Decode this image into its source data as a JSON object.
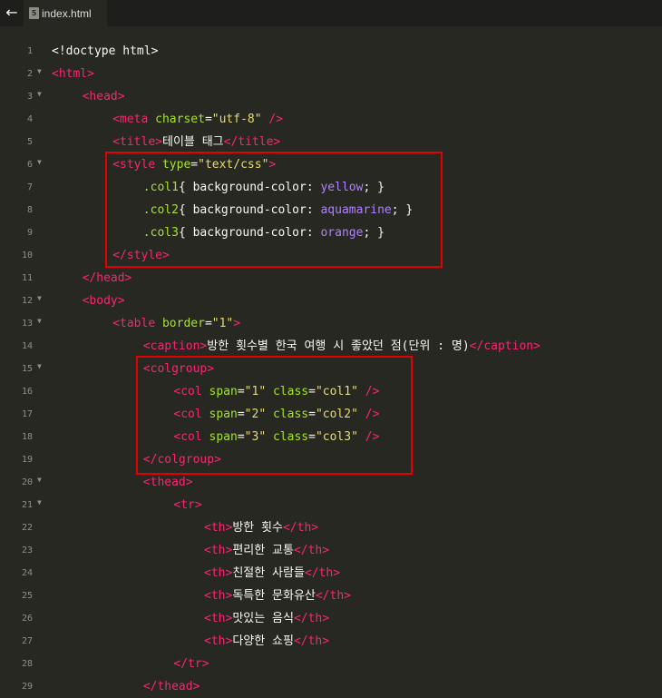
{
  "tab": {
    "back_glyph": "←",
    "icon_glyph": "5",
    "file_name": "index.html"
  },
  "lines": [
    {
      "n": "1",
      "fold": false,
      "indent": 0,
      "tokens": [
        {
          "t": "<!doctype html>",
          "c": "txt"
        }
      ]
    },
    {
      "n": "2",
      "fold": true,
      "indent": 0,
      "tokens": [
        {
          "t": "<html>",
          "c": "tag"
        }
      ]
    },
    {
      "n": "3",
      "fold": true,
      "indent": 1,
      "tokens": [
        {
          "t": "<head>",
          "c": "tag"
        }
      ]
    },
    {
      "n": "4",
      "fold": false,
      "indent": 2,
      "tokens": [
        {
          "t": "<meta ",
          "c": "tag"
        },
        {
          "t": "charset",
          "c": "attr"
        },
        {
          "t": "=",
          "c": "txt"
        },
        {
          "t": "\"utf-8\"",
          "c": "str"
        },
        {
          "t": " />",
          "c": "tag"
        }
      ]
    },
    {
      "n": "5",
      "fold": false,
      "indent": 2,
      "tokens": [
        {
          "t": "<title>",
          "c": "tag"
        },
        {
          "t": "테이블 태그",
          "c": "txt"
        },
        {
          "t": "</title>",
          "c": "tag"
        }
      ]
    },
    {
      "n": "6",
      "fold": true,
      "indent": 2,
      "tokens": [
        {
          "t": "<style ",
          "c": "tag"
        },
        {
          "t": "type",
          "c": "attr"
        },
        {
          "t": "=",
          "c": "txt"
        },
        {
          "t": "\"text/css\"",
          "c": "str"
        },
        {
          "t": ">",
          "c": "tag"
        }
      ]
    },
    {
      "n": "7",
      "fold": false,
      "indent": 3,
      "tokens": [
        {
          "t": ".col1",
          "c": "cls"
        },
        {
          "t": "{ background-color: ",
          "c": "txt"
        },
        {
          "t": "yellow",
          "c": "val"
        },
        {
          "t": "; }",
          "c": "txt"
        }
      ]
    },
    {
      "n": "8",
      "fold": false,
      "indent": 3,
      "tokens": [
        {
          "t": ".col2",
          "c": "cls"
        },
        {
          "t": "{ background-color: ",
          "c": "txt"
        },
        {
          "t": "aquamarine",
          "c": "val"
        },
        {
          "t": "; }",
          "c": "txt"
        }
      ]
    },
    {
      "n": "9",
      "fold": false,
      "indent": 3,
      "tokens": [
        {
          "t": ".col3",
          "c": "cls"
        },
        {
          "t": "{ background-color: ",
          "c": "txt"
        },
        {
          "t": "orange",
          "c": "val"
        },
        {
          "t": "; }",
          "c": "txt"
        }
      ]
    },
    {
      "n": "10",
      "fold": false,
      "indent": 2,
      "tokens": [
        {
          "t": "</style>",
          "c": "tag"
        }
      ]
    },
    {
      "n": "11",
      "fold": false,
      "indent": 1,
      "tokens": [
        {
          "t": "</head>",
          "c": "tag"
        }
      ]
    },
    {
      "n": "12",
      "fold": true,
      "indent": 1,
      "tokens": [
        {
          "t": "<body>",
          "c": "tag"
        }
      ]
    },
    {
      "n": "13",
      "fold": true,
      "indent": 2,
      "tokens": [
        {
          "t": "<table ",
          "c": "tag"
        },
        {
          "t": "border",
          "c": "attr"
        },
        {
          "t": "=",
          "c": "txt"
        },
        {
          "t": "\"1\"",
          "c": "str"
        },
        {
          "t": ">",
          "c": "tag"
        }
      ]
    },
    {
      "n": "14",
      "fold": false,
      "indent": 3,
      "tokens": [
        {
          "t": "<caption>",
          "c": "tag"
        },
        {
          "t": "방한 횟수별 한국 여행 시 좋았던 점(단위 : 명)",
          "c": "txt"
        },
        {
          "t": "</caption>",
          "c": "tag"
        }
      ]
    },
    {
      "n": "15",
      "fold": true,
      "indent": 3,
      "tokens": [
        {
          "t": "<colgroup>",
          "c": "tag"
        }
      ]
    },
    {
      "n": "16",
      "fold": false,
      "indent": 4,
      "tokens": [
        {
          "t": "<col ",
          "c": "tag"
        },
        {
          "t": "span",
          "c": "attr"
        },
        {
          "t": "=",
          "c": "txt"
        },
        {
          "t": "\"1\"",
          "c": "str"
        },
        {
          "t": " ",
          "c": "txt"
        },
        {
          "t": "class",
          "c": "attr"
        },
        {
          "t": "=",
          "c": "txt"
        },
        {
          "t": "\"col1\"",
          "c": "str"
        },
        {
          "t": " />",
          "c": "tag"
        }
      ]
    },
    {
      "n": "17",
      "fold": false,
      "indent": 4,
      "tokens": [
        {
          "t": "<col ",
          "c": "tag"
        },
        {
          "t": "span",
          "c": "attr"
        },
        {
          "t": "=",
          "c": "txt"
        },
        {
          "t": "\"2\"",
          "c": "str"
        },
        {
          "t": " ",
          "c": "txt"
        },
        {
          "t": "class",
          "c": "attr"
        },
        {
          "t": "=",
          "c": "txt"
        },
        {
          "t": "\"col2\"",
          "c": "str"
        },
        {
          "t": " />",
          "c": "tag"
        }
      ]
    },
    {
      "n": "18",
      "fold": false,
      "indent": 4,
      "tokens": [
        {
          "t": "<col ",
          "c": "tag"
        },
        {
          "t": "span",
          "c": "attr"
        },
        {
          "t": "=",
          "c": "txt"
        },
        {
          "t": "\"3\"",
          "c": "str"
        },
        {
          "t": " ",
          "c": "txt"
        },
        {
          "t": "class",
          "c": "attr"
        },
        {
          "t": "=",
          "c": "txt"
        },
        {
          "t": "\"col3\"",
          "c": "str"
        },
        {
          "t": " />",
          "c": "tag"
        }
      ]
    },
    {
      "n": "19",
      "fold": false,
      "indent": 3,
      "tokens": [
        {
          "t": "</colgroup>",
          "c": "tag"
        }
      ]
    },
    {
      "n": "20",
      "fold": true,
      "indent": 3,
      "tokens": [
        {
          "t": "<thead>",
          "c": "tag"
        }
      ]
    },
    {
      "n": "21",
      "fold": true,
      "indent": 4,
      "tokens": [
        {
          "t": "<tr>",
          "c": "tag"
        }
      ]
    },
    {
      "n": "22",
      "fold": false,
      "indent": 5,
      "tokens": [
        {
          "t": "<th>",
          "c": "tag"
        },
        {
          "t": "방한 횟수",
          "c": "txt"
        },
        {
          "t": "</th>",
          "c": "tag"
        }
      ]
    },
    {
      "n": "23",
      "fold": false,
      "indent": 5,
      "tokens": [
        {
          "t": "<th>",
          "c": "tag"
        },
        {
          "t": "편리한 교통",
          "c": "txt"
        },
        {
          "t": "</th>",
          "c": "tag"
        }
      ]
    },
    {
      "n": "24",
      "fold": false,
      "indent": 5,
      "tokens": [
        {
          "t": "<th>",
          "c": "tag"
        },
        {
          "t": "친절한 사람들",
          "c": "txt"
        },
        {
          "t": "</th>",
          "c": "tag"
        }
      ]
    },
    {
      "n": "25",
      "fold": false,
      "indent": 5,
      "tokens": [
        {
          "t": "<th>",
          "c": "tag"
        },
        {
          "t": "독특한 문화유산",
          "c": "txt"
        },
        {
          "t": "</th>",
          "c": "tag"
        }
      ]
    },
    {
      "n": "26",
      "fold": false,
      "indent": 5,
      "tokens": [
        {
          "t": "<th>",
          "c": "tag"
        },
        {
          "t": "맛있는 음식",
          "c": "txt"
        },
        {
          "t": "</th>",
          "c": "tag"
        }
      ]
    },
    {
      "n": "27",
      "fold": false,
      "indent": 5,
      "tokens": [
        {
          "t": "<th>",
          "c": "tag"
        },
        {
          "t": "다양한 쇼핑",
          "c": "txt"
        },
        {
          "t": "</th>",
          "c": "tag"
        }
      ]
    },
    {
      "n": "28",
      "fold": false,
      "indent": 4,
      "tokens": [
        {
          "t": "</tr>",
          "c": "tag"
        }
      ]
    },
    {
      "n": "29",
      "fold": false,
      "indent": 3,
      "tokens": [
        {
          "t": "</thead>",
          "c": "tag"
        }
      ]
    }
  ],
  "colors": {
    "background": "#272822",
    "tag": "#f92672",
    "attr": "#a6e22e",
    "string": "#e6db74",
    "value": "#ae81ff",
    "highlight": "#e20000"
  }
}
